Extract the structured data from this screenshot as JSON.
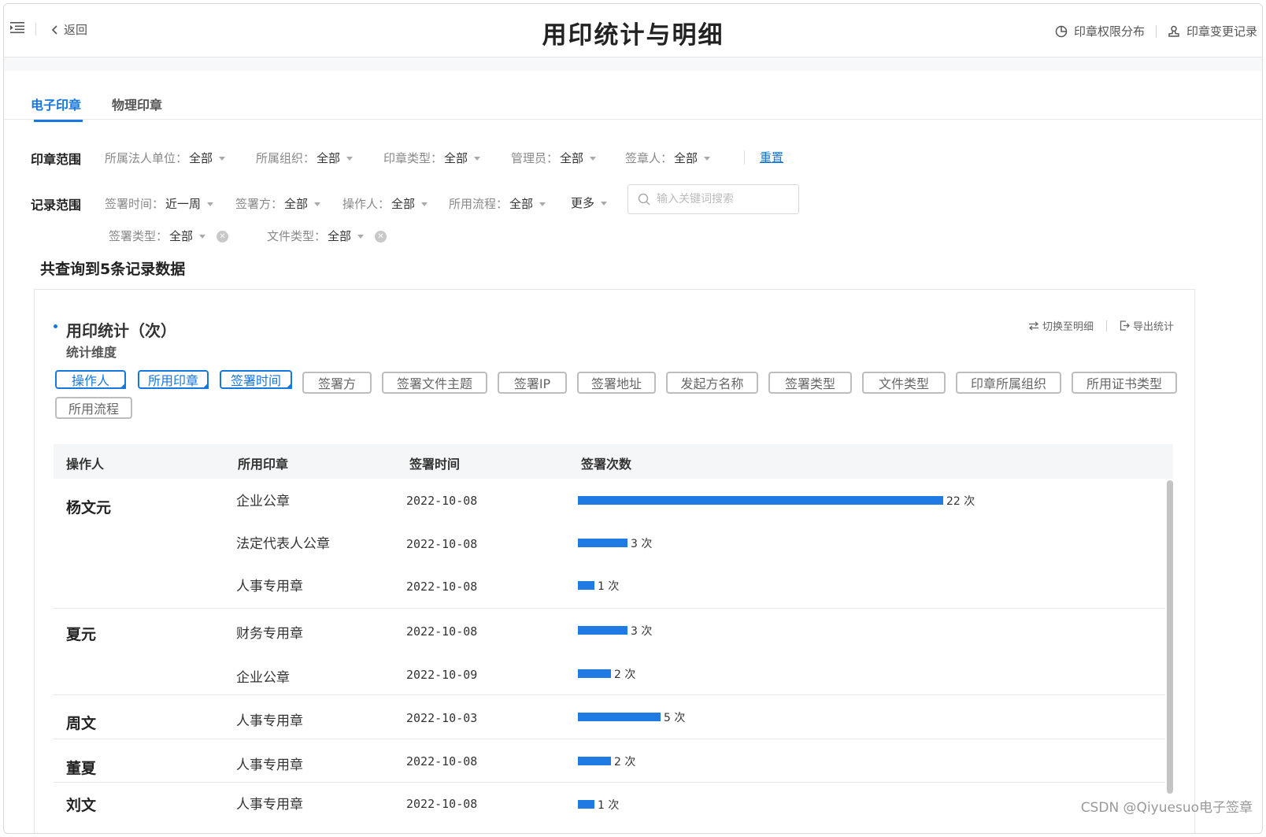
{
  "header": {
    "back_label": "返回",
    "title": "用印统计与明细",
    "link_permissions": "印章权限分布",
    "link_changes": "印章变更记录"
  },
  "tabs": [
    {
      "label": "电子印章",
      "active": true
    },
    {
      "label": "物理印章",
      "active": false
    }
  ],
  "seal_scope": {
    "label": "印章范围",
    "filters": [
      {
        "name": "所属法人单位：",
        "value": "全部"
      },
      {
        "name": "所属组织：",
        "value": "全部"
      },
      {
        "name": "印章类型：",
        "value": "全部"
      },
      {
        "name": "管理员：",
        "value": "全部"
      },
      {
        "name": "签章人：",
        "value": "全部"
      }
    ],
    "reset_label": "重置"
  },
  "record_scope": {
    "label": "记录范围",
    "filters": [
      {
        "name": "签署时间：",
        "value": "近一周"
      },
      {
        "name": "签署方：",
        "value": "全部"
      },
      {
        "name": "操作人：",
        "value": "全部"
      },
      {
        "name": "所用流程：",
        "value": "全部"
      }
    ],
    "more_label": "更多",
    "search_placeholder": "输入关键词搜索",
    "extra_filters": [
      {
        "name": "签署类型：",
        "value": "全部"
      },
      {
        "name": "文件类型：",
        "value": "全部"
      }
    ]
  },
  "result_count": "共查询到5条记录数据",
  "stats_card": {
    "title": "用印统计（次）",
    "subtitle": "统计维度",
    "action_switch": "切换至明细",
    "action_export": "导出统计",
    "dimensions": [
      {
        "label": "操作人",
        "selected": true
      },
      {
        "label": "所用印章",
        "selected": true
      },
      {
        "label": "签署时间",
        "selected": true
      },
      {
        "label": "签署方",
        "selected": false
      },
      {
        "label": "签署文件主题",
        "selected": false
      },
      {
        "label": "签署IP",
        "selected": false
      },
      {
        "label": "签署地址",
        "selected": false
      },
      {
        "label": "发起方名称",
        "selected": false
      },
      {
        "label": "签署类型",
        "selected": false
      },
      {
        "label": "文件类型",
        "selected": false
      },
      {
        "label": "印章所属组织",
        "selected": false
      },
      {
        "label": "所用证书类型",
        "selected": false
      },
      {
        "label": "所用流程",
        "selected": false
      }
    ],
    "columns": [
      "操作人",
      "所用印章",
      "签署时间",
      "签署次数"
    ],
    "count_unit": "次",
    "max_count": 22,
    "groups": [
      {
        "operator": "杨文元",
        "rows": [
          {
            "seal": "企业公章",
            "date": "2022-10-08",
            "count": 22
          },
          {
            "seal": "法定代表人公章",
            "date": "2022-10-08",
            "count": 3
          },
          {
            "seal": "人事专用章",
            "date": "2022-10-08",
            "count": 1
          }
        ]
      },
      {
        "operator": "夏元",
        "rows": [
          {
            "seal": "财务专用章",
            "date": "2022-10-08",
            "count": 3
          },
          {
            "seal": "企业公章",
            "date": "2022-10-09",
            "count": 2
          }
        ]
      },
      {
        "operator": "周文",
        "rows": [
          {
            "seal": "人事专用章",
            "date": "2022-10-03",
            "count": 5
          }
        ]
      },
      {
        "operator": "董夏",
        "rows": [
          {
            "seal": "人事专用章",
            "date": "2022-10-08",
            "count": 2
          }
        ]
      },
      {
        "operator": "刘文",
        "rows": [
          {
            "seal": "人事专用章",
            "date": "2022-10-08",
            "count": 1
          }
        ]
      }
    ]
  },
  "watermark": "CSDN @Qiyuesuo电子签章",
  "colors": {
    "accent": "#1677e0",
    "bar": "#1f7be3"
  }
}
